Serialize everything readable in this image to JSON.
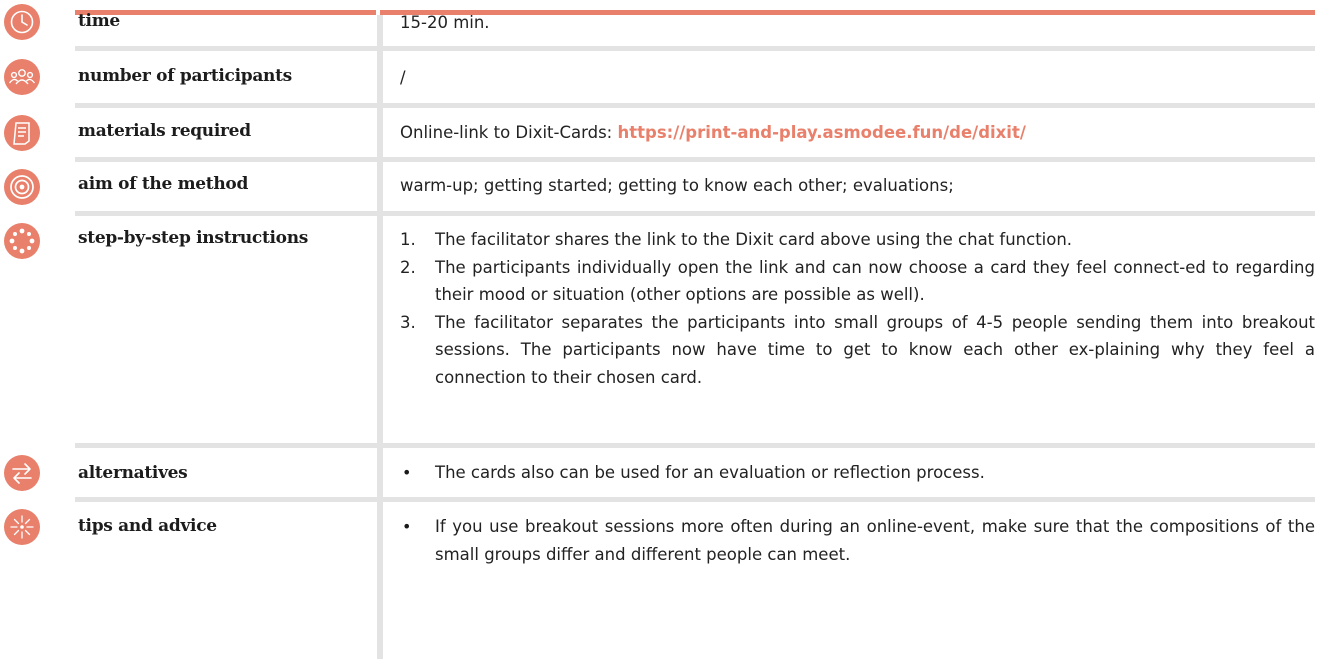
{
  "theme": {
    "accent": "#e8806b",
    "rule": "#e3e3e3"
  },
  "rows": {
    "time": {
      "icon": "clock-icon",
      "label": "time",
      "value": "15-20 min."
    },
    "participants": {
      "icon": "people-icon",
      "label": "number of participants",
      "value": "/"
    },
    "materials": {
      "icon": "document-icon",
      "label": "materials required",
      "value_prefix": "Online-link to Dixit-Cards: ",
      "link": "https://print-and-play.asmodee.fun/de/dixit/"
    },
    "aim": {
      "icon": "target-icon",
      "label": "aim of the method",
      "value": "warm-up; getting started; getting to know each other; evaluations;"
    },
    "steps": {
      "icon": "dots-circle-icon",
      "label": "step-by-step instructions",
      "items": [
        {
          "num": "1.",
          "text": "The facilitator shares the link to the Dixit card above using the chat function."
        },
        {
          "num": "2.",
          "text": "The participants individually open the link and can now choose a card they feel connect-ed to regarding their mood or situation (other options are possible as well)."
        },
        {
          "num": "3.",
          "text": "The facilitator separates the participants into small groups of 4-5 people sending them into breakout sessions. The participants now have time to get to know each other ex-plaining why they feel a connection to their chosen card."
        }
      ]
    },
    "alternatives": {
      "icon": "arrows-icon",
      "label": "alternatives",
      "bullet": "•",
      "text": "The cards also can be used for an evaluation or reflection process."
    },
    "tips": {
      "icon": "sparkle-icon",
      "label": "tips and advice",
      "bullet": "•",
      "text": "If you use breakout sessions more often during an online-event, make sure that the compositions of the small groups differ and different people can meet."
    }
  }
}
